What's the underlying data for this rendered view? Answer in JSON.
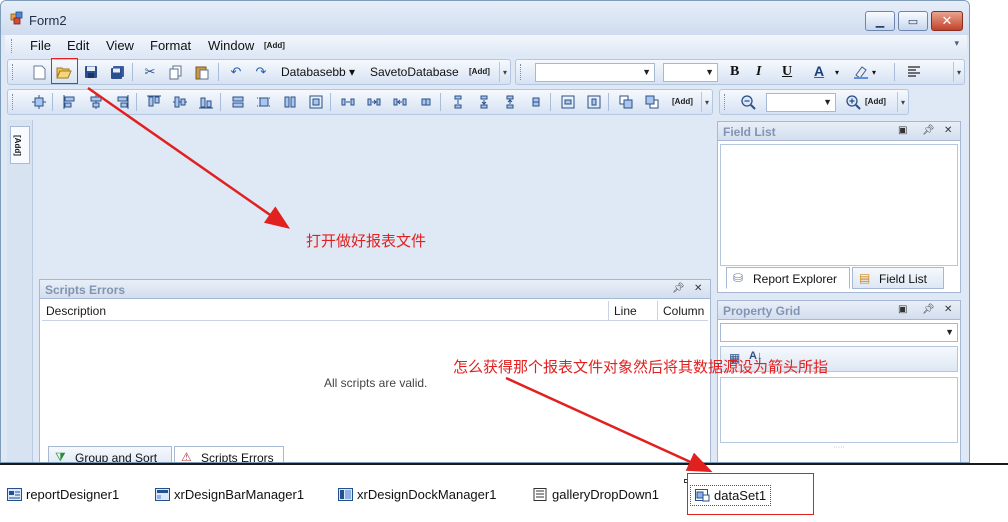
{
  "window": {
    "title": "Form2"
  },
  "menubar": {
    "items": [
      "File",
      "Edit",
      "View",
      "Format",
      "Window"
    ],
    "add_label": "[Add]"
  },
  "toolbar1": {
    "combo_database": "Databasebb",
    "save_to_database": "SavetoDatabase",
    "add_label": "[Add]",
    "bold": "B",
    "italic": "I",
    "underline": "U",
    "font_color": "A"
  },
  "toolbar2": {
    "add_label": "[Add]",
    "zoom_add_label": "[Add]"
  },
  "left_strip": {
    "tab_label": "[Add]"
  },
  "field_list": {
    "title": "Field List",
    "tabs": [
      "Report Explorer",
      "Field List"
    ]
  },
  "property_grid": {
    "title": "Property Grid"
  },
  "scripts_errors": {
    "title": "Scripts Errors",
    "columns": [
      "Description",
      "Line",
      "Column"
    ],
    "message": "All scripts are valid.",
    "tabs": [
      "Group and Sort",
      "Scripts Errors"
    ]
  },
  "tray": {
    "items": [
      "reportDesigner1",
      "xrDesignBarManager1",
      "xrDesignDockManager1",
      "galleryDropDown1",
      "dataSet1"
    ]
  },
  "annotations": {
    "open_file_note": "打开做好报表文件",
    "datasource_note": "怎么获得那个报表文件对象然后将其数据源设为箭头所指"
  },
  "colors": {
    "annotation": "#e12020",
    "accent": "#2c4f86",
    "frame": "#dfe8f5"
  }
}
